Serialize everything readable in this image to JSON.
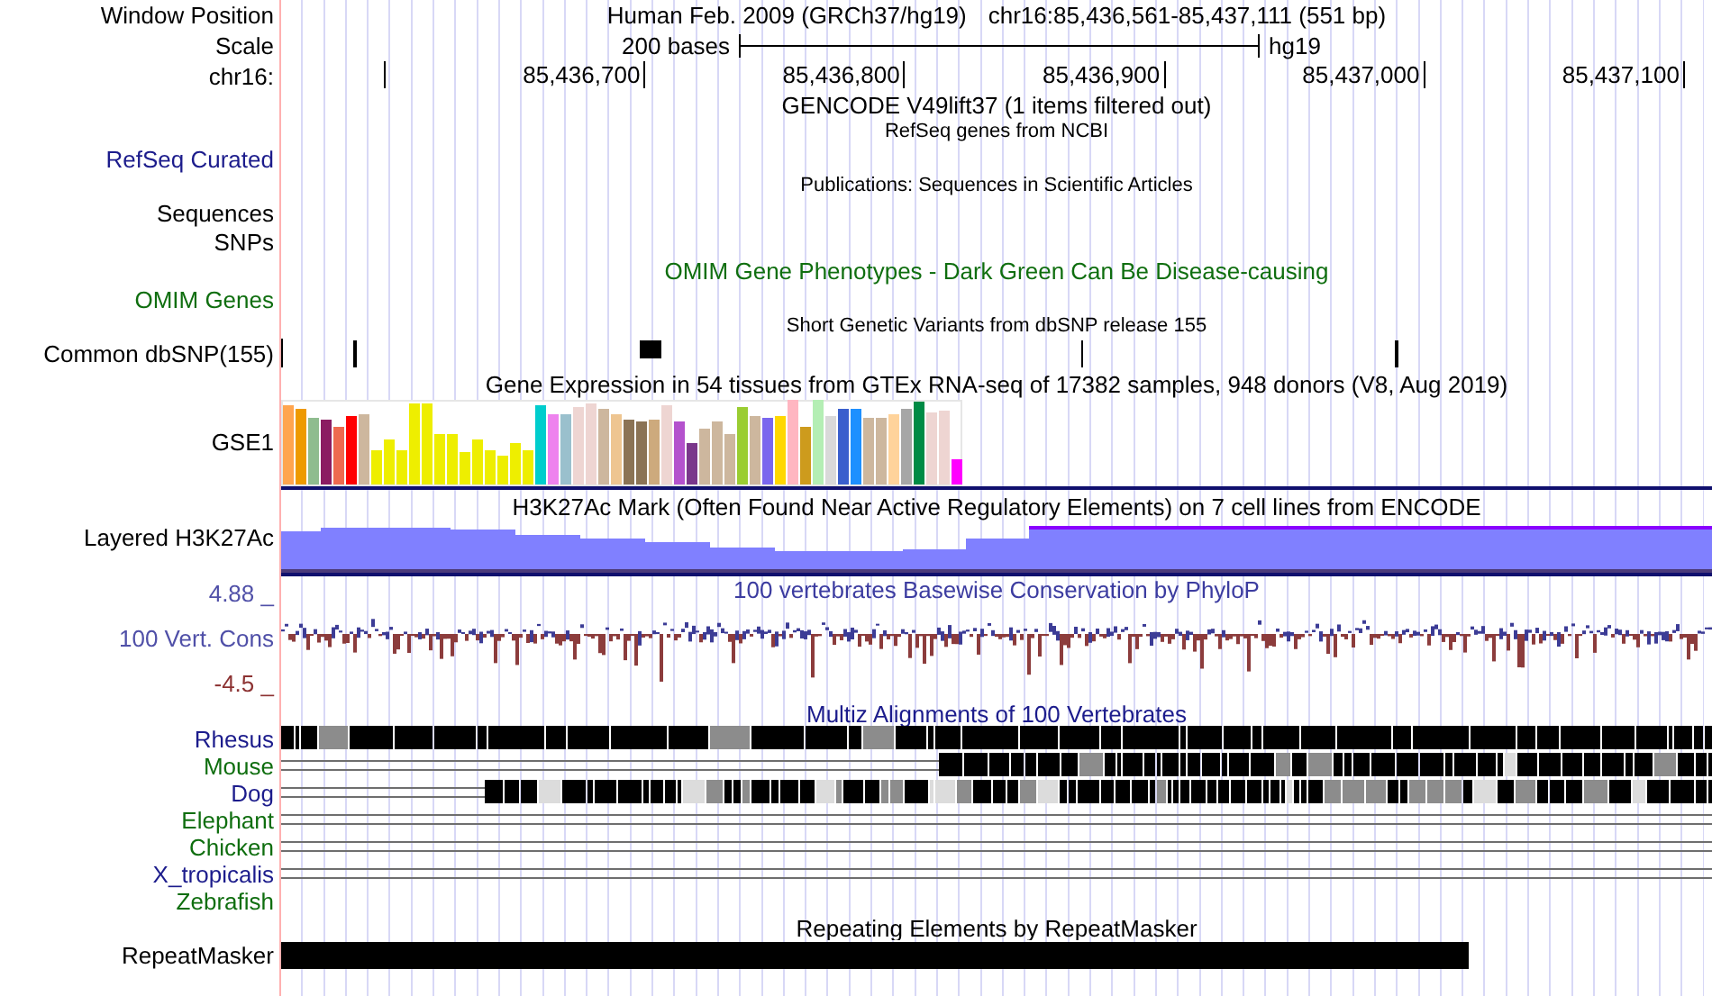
{
  "position": {
    "label": "Window Position",
    "assembly": "Human Feb. 2009 (GRCh37/hg19)",
    "range": "chr16:85,436,561-85,437,111 (551 bp)"
  },
  "scale": {
    "label": "Scale",
    "length": "200 bases",
    "assembly": "hg19"
  },
  "ruler": {
    "label": "chr16:",
    "ticks": [
      "85,436,700",
      "85,436,800",
      "85,436,900",
      "85,437,000",
      "85,437,100"
    ]
  },
  "gencode": {
    "title": "GENCODE V49lift37 (1 items filtered out)"
  },
  "refseq": {
    "title": "RefSeq genes from NCBI",
    "label": "RefSeq Curated",
    "color": "#1c1c8c"
  },
  "publications": {
    "title": "Publications: Sequences in Scientific Articles",
    "labels": [
      "Sequences",
      "SNPs"
    ]
  },
  "omim": {
    "title": "OMIM Gene Phenotypes - Dark Green Can Be Disease-causing",
    "label": "OMIM Genes",
    "color": "#0f6e0f"
  },
  "dbsnp": {
    "title": "Short Genetic Variants from dbSNP release 155",
    "label": "Common dbSNP(155)"
  },
  "gtex": {
    "title": "Gene Expression in 54 tissues from GTEx RNA-seq of 17382 samples, 948 donors (V8, Aug 2019)",
    "label": "GSE1"
  },
  "h3k27ac": {
    "title": "H3K27Ac Mark (Often Found Near Active Regulatory Elements) on 7 cell lines from ENCODE",
    "label": "Layered H3K27Ac"
  },
  "conservation": {
    "title": "100 vertebrates Basewise Conservation by PhyloP",
    "label": "100 Vert. Cons",
    "max": "4.88 _",
    "min": "-4.5 _"
  },
  "multiz": {
    "title": "Multiz Alignments of 100 Vertebrates",
    "species": [
      {
        "name": "Rhesus",
        "color": "#1c1c8c",
        "kind": "full"
      },
      {
        "name": "Mouse",
        "color": "#0f6e0f",
        "kind": "partial"
      },
      {
        "name": "Dog",
        "color": "#1c1c8c",
        "kind": "partial"
      },
      {
        "name": "Elephant",
        "color": "#0f6e0f",
        "kind": "lines"
      },
      {
        "name": "Chicken",
        "color": "#0f6e0f",
        "kind": "lines"
      },
      {
        "name": "X_tropicalis",
        "color": "#1c1c8c",
        "kind": "lines"
      },
      {
        "name": "Zebrafish",
        "color": "#0f6e0f",
        "kind": "none"
      }
    ]
  },
  "repeatmasker": {
    "title": "Repeating Elements by RepeatMasker",
    "label": "RepeatMasker"
  }
}
